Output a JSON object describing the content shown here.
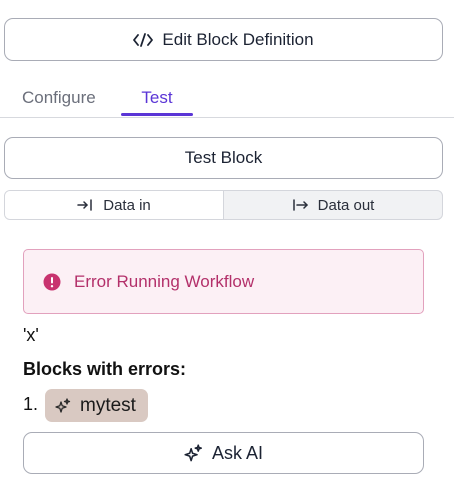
{
  "header": {
    "edit_button_label": "Edit Block Definition",
    "edit_icon": "code-icon"
  },
  "tabs": [
    {
      "label": "Configure",
      "active": false
    },
    {
      "label": "Test",
      "active": true
    }
  ],
  "accent_color": "#5a35d6",
  "test": {
    "test_button_label": "Test Block",
    "segments": [
      {
        "label": "Data in",
        "icon": "arrow-to-bar-right-icon",
        "active": true
      },
      {
        "label": "Data out",
        "icon": "bar-arrow-right-icon",
        "active": false
      }
    ]
  },
  "error": {
    "title": "Error Running Workflow",
    "icon": "alert-circle-icon",
    "color": "#b3306a",
    "message": "'x'",
    "blocks_heading": "Blocks with errors:",
    "blocks": [
      {
        "number": "1.",
        "name": "mytest",
        "icon": "sparkles-icon"
      }
    ]
  },
  "ask_ai": {
    "label": "Ask AI",
    "icon": "sparkles-icon"
  }
}
